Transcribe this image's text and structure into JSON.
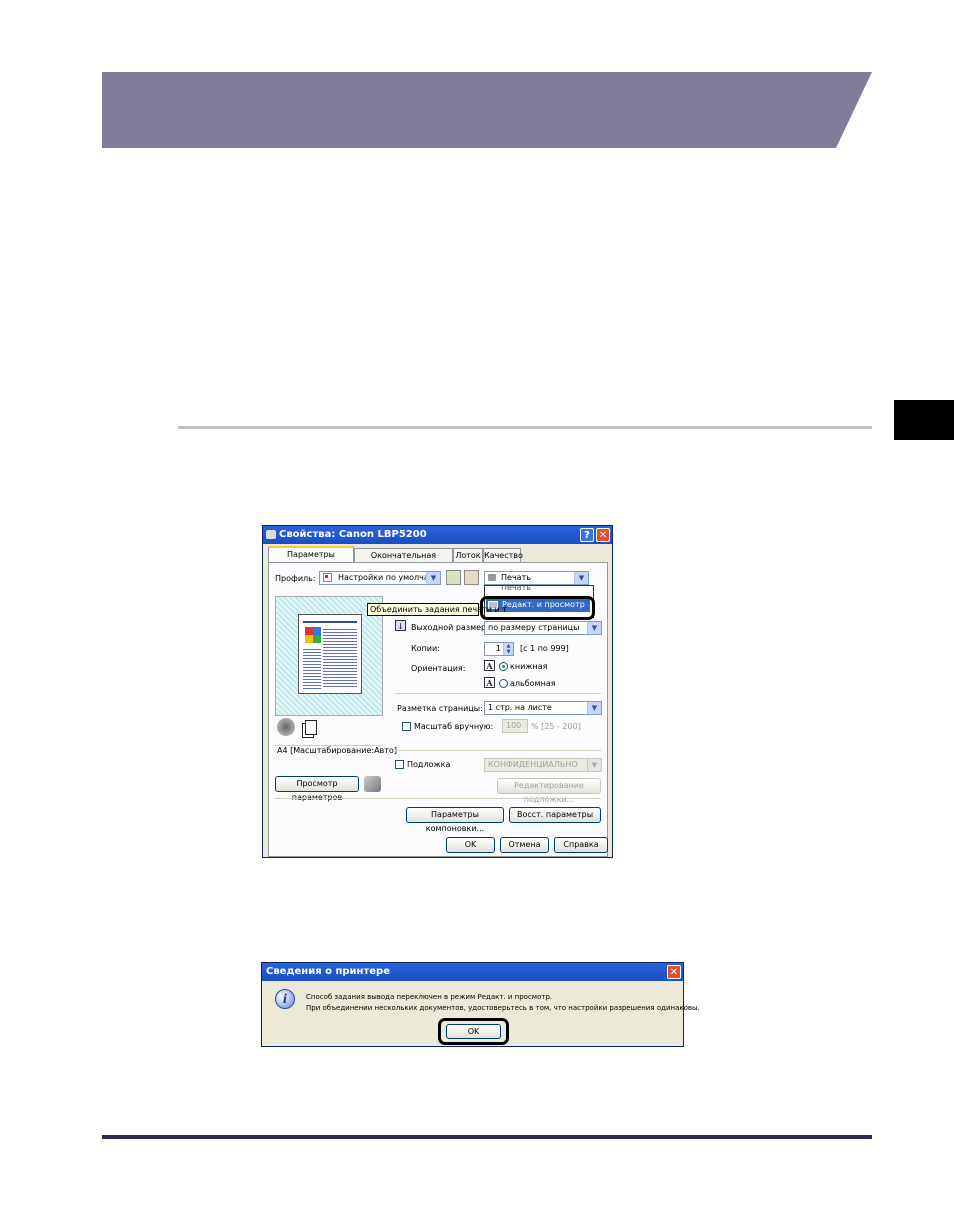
{
  "properties_dialog": {
    "title": "Свойства: Canon LBP5200",
    "help_btn": "?",
    "close_btn": "✕",
    "tabs": [
      "Параметры страницы",
      "Окончательная обработка",
      "Лоток",
      "Качество"
    ],
    "profile_label": "Профиль:",
    "profile_value": "Настройки по умолчанию",
    "output_method_value": "Печать",
    "output_method_list_partial": "Печать",
    "output_method_highlighted": "Редакт. и просмотр",
    "tooltip": "Объединить задания печати и т",
    "output_size_label": "Выходной размер:",
    "output_size_value": "по размеру страницы",
    "copies_label": "Копии:",
    "copies_value": "1",
    "copies_range": "[с 1 по 999]",
    "orientation_label": "Ориентация:",
    "orientation_portrait": "книжная",
    "orientation_landscape": "альбомная",
    "page_layout_label": "Разметка страницы:",
    "page_layout_value": "1 стр. на листе",
    "manual_scale_label": "Масштаб вручную:",
    "manual_scale_value": "100",
    "manual_scale_range": "% [25 - 200]",
    "watermark_label": "Подложка",
    "watermark_value": "КОНФИДЕНЦИАЛЬНО",
    "edit_watermark_btn": "Редактирование подложки...",
    "preview_caption": "A4 [Масштабирование:Авто]",
    "view_settings_btn": "Просмотр параметров",
    "layout_settings_btn": "Параметры компоновки...",
    "restore_btn": "Восст. параметры",
    "ok_btn": "OK",
    "cancel_btn": "Отмена",
    "help_button": "Справка"
  },
  "info_dialog": {
    "title": "Сведения о принтере",
    "close_btn": "✕",
    "message_line1": "Способ задания вывода переключен в режим Редакт. и просмотр.",
    "message_line2": "При объединении нескольких документов, удостоверьтесь в том, что настройки разрешения одинаковы.",
    "ok_btn": "OK"
  },
  "colors": {
    "header_band": "#807c9c",
    "footer_rule": "#2e2a52",
    "highlight_blue": "#316ac5"
  }
}
